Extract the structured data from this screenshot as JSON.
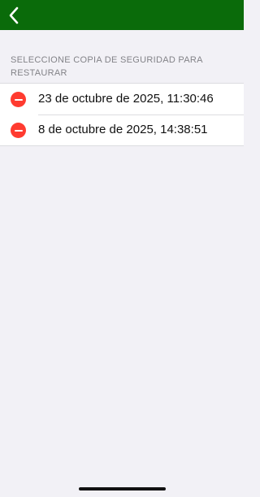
{
  "navbar": {
    "back_icon": "chevron-left-icon",
    "color": "#0a6b0a"
  },
  "section": {
    "header": "SELECCIONE COPIA DE SEGURIDAD PARA RESTAURAR"
  },
  "backups": [
    {
      "label": "23 de octubre de 2025, 11:30:46",
      "icon": "minus-circle-icon"
    },
    {
      "label": "8 de octubre de 2025, 14:38:51",
      "icon": "minus-circle-icon"
    }
  ],
  "colors": {
    "delete": "#ff3b30",
    "background": "#f2f1f6"
  }
}
